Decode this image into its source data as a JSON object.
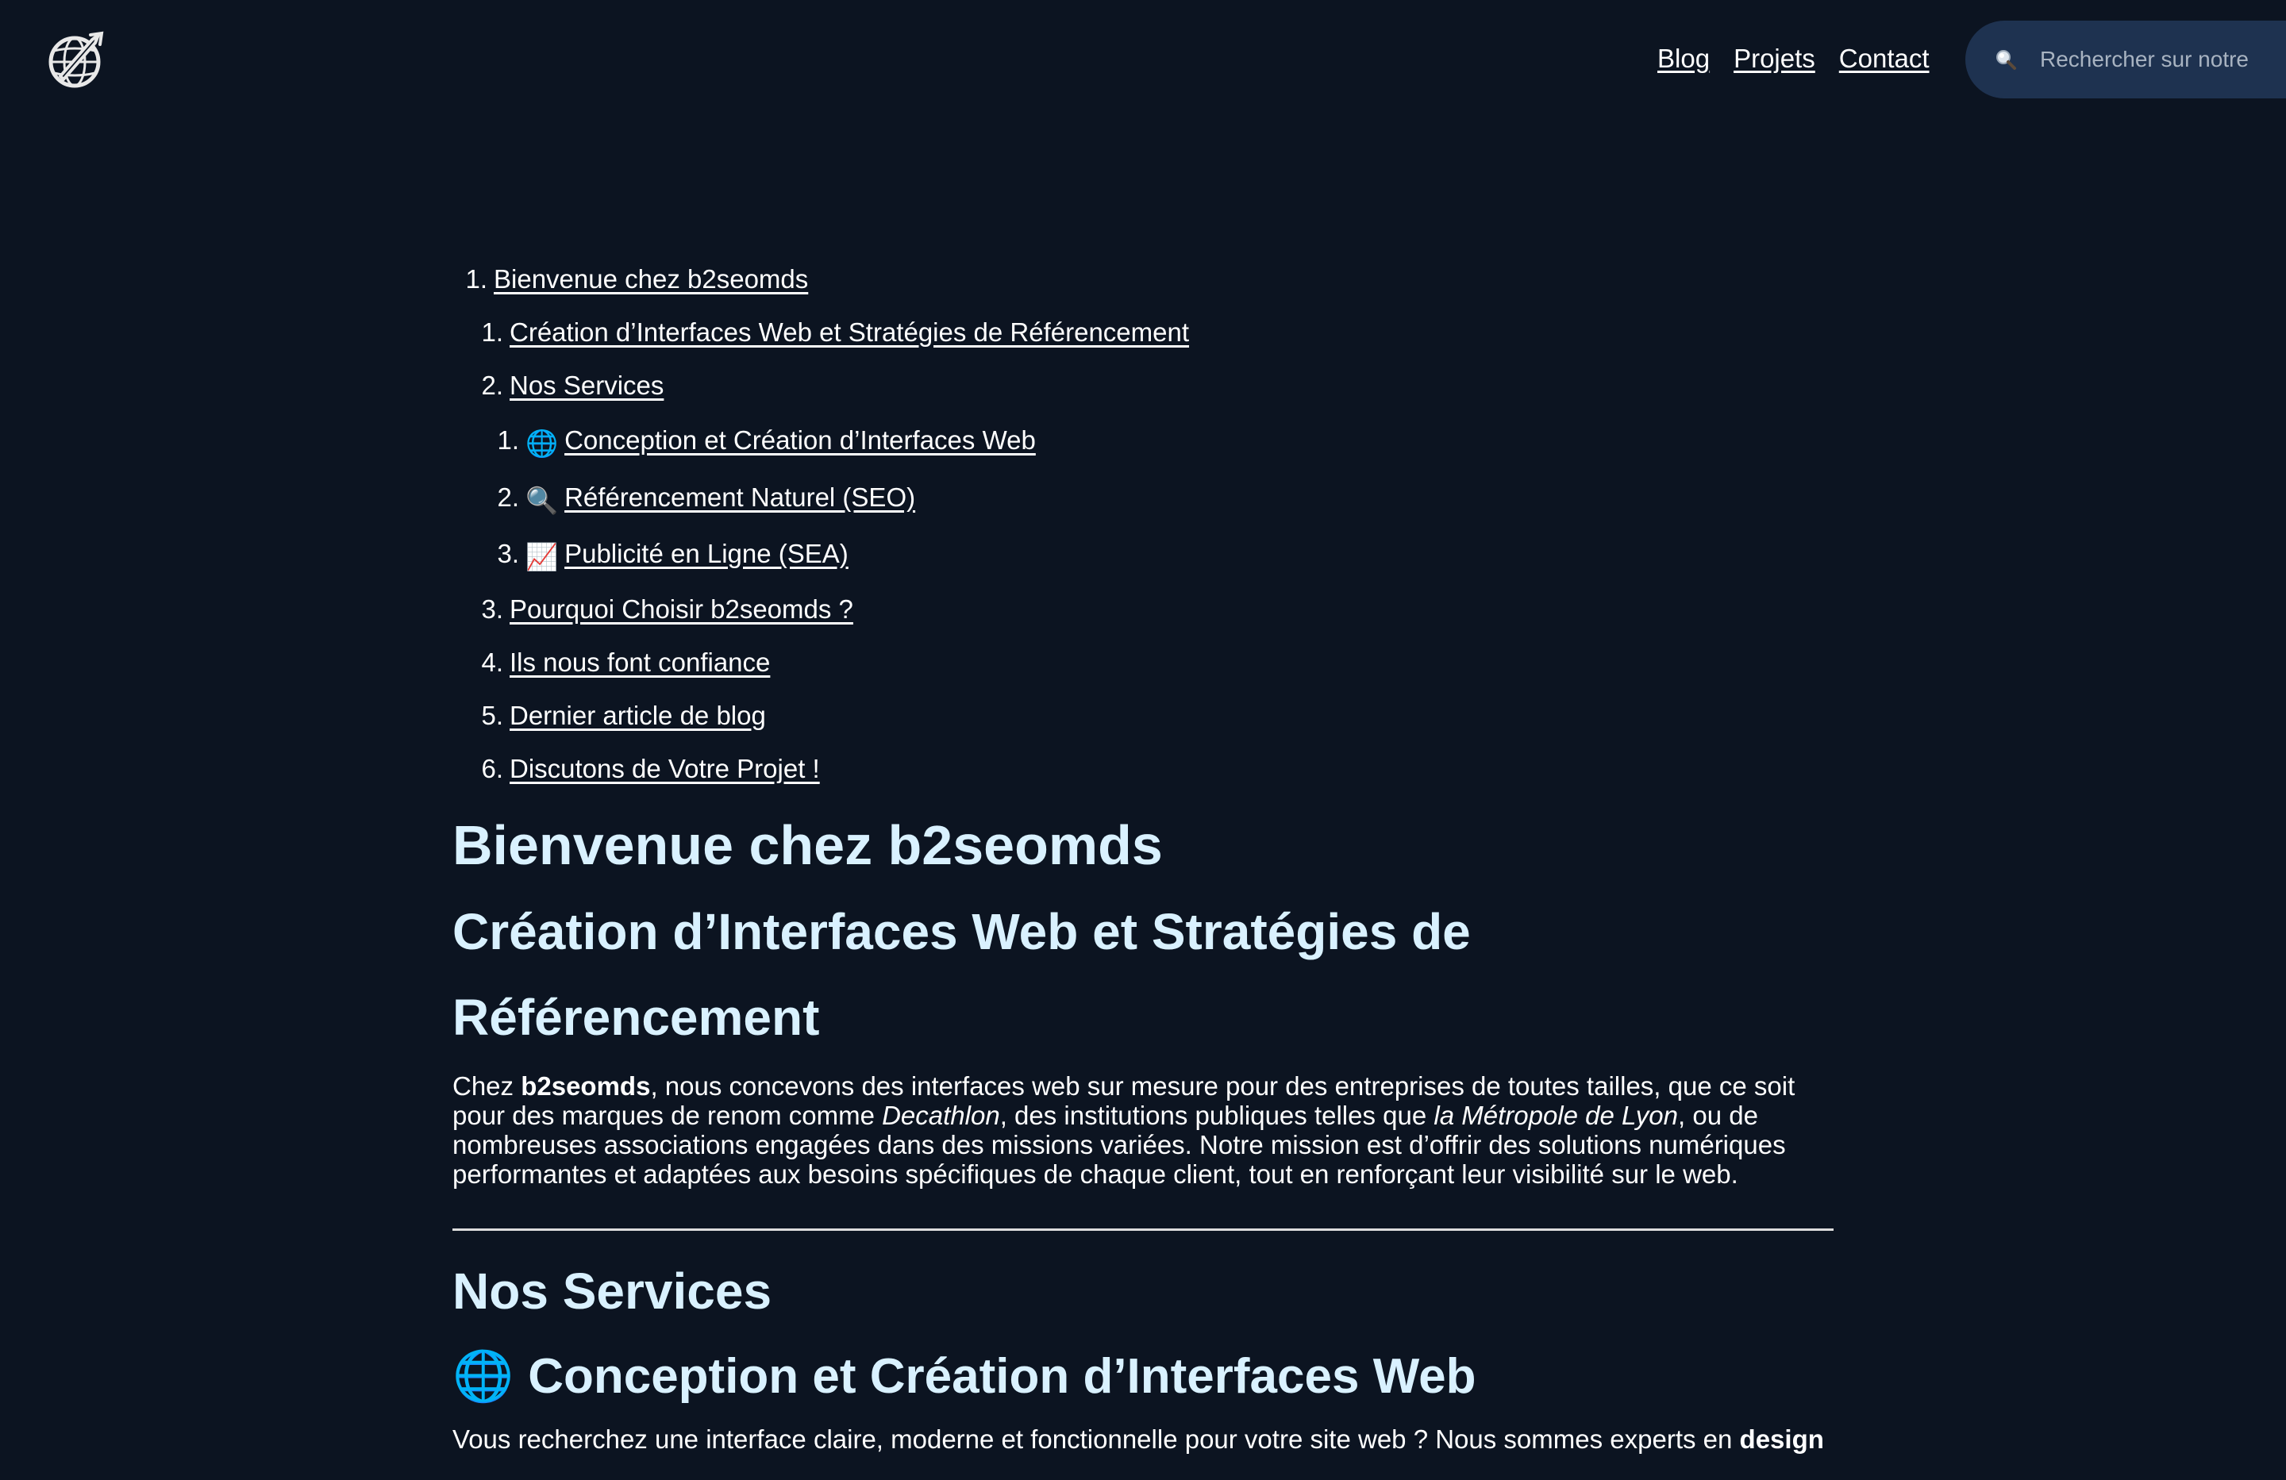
{
  "header": {
    "logo_icon": "globe-rocket-logo-icon",
    "nav": [
      {
        "label": "Blog"
      },
      {
        "label": "Projets"
      },
      {
        "label": "Contact"
      }
    ],
    "search": {
      "icon": "search-icon",
      "placeholder": "Rechercher sur notre"
    }
  },
  "toc": {
    "items": [
      {
        "number": "1.",
        "label": "Bienvenue chez b2seomds",
        "level": 1
      },
      {
        "number": "1.",
        "label": "Création d’Interfaces Web et Stratégies de Référencement",
        "level": 2
      },
      {
        "number": "2.",
        "label": "Nos Services",
        "level": 2
      },
      {
        "number": "1.",
        "emoji": "🌐",
        "label": "Conception et Création d’Interfaces Web",
        "level": 3
      },
      {
        "number": "2.",
        "emoji": "🔍",
        "label": "Référencement Naturel (SEO)",
        "level": 3
      },
      {
        "number": "3.",
        "emoji": "📈",
        "label": "Publicité en Ligne (SEA)",
        "level": 3
      },
      {
        "number": "3.",
        "label": "Pourquoi Choisir b2seomds ?",
        "level": 2
      },
      {
        "number": "4.",
        "label": "Ils nous font confiance",
        "level": 2
      },
      {
        "number": "5.",
        "label": "Dernier article de blog",
        "level": 2
      },
      {
        "number": "6.",
        "label": "Discutons de Votre Projet !",
        "level": 2
      }
    ]
  },
  "content": {
    "title": "Bienvenue chez b2seomds",
    "subtitle": "Création d’Interfaces Web et Stratégies de Référencement",
    "intro": {
      "p1": "Chez ",
      "brand": "b2seomds",
      "p2": ", nous concevons des interfaces web sur mesure pour des entreprises de toutes tailles, que ce soit pour des marques de renom comme ",
      "decathlon": "Decathlon",
      "p3": ", des institutions publiques telles que ",
      "metropole": "la Métropole de Lyon",
      "p4": ", ou de nombreuses associations engagées dans des missions variées. Notre mission est d’offrir des solutions numériques performantes et adaptées aux besoins spécifiques de chaque client, tout en renforçant leur visibilité sur le web."
    },
    "services_heading": "Nos Services",
    "service1": {
      "emoji": "🌐",
      "heading": "Conception et Création d’Interfaces Web",
      "text_start": "Vous recherchez une interface claire, moderne et fonctionnelle pour votre site web ? Nous sommes experts en ",
      "text_bold": "design"
    }
  }
}
